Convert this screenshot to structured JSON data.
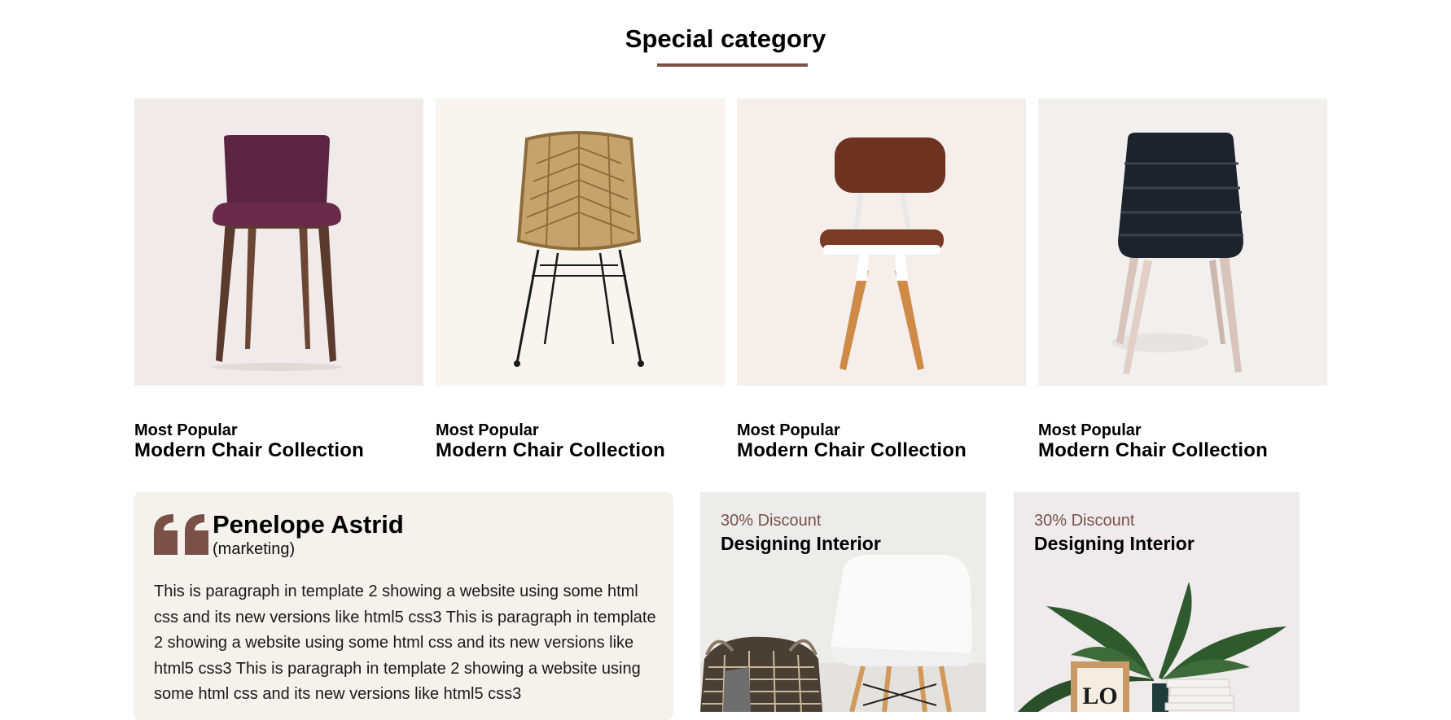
{
  "section": {
    "title": "Special category"
  },
  "cards": [
    {
      "tag": "Most Popular",
      "title": "Modern Chair Collection"
    },
    {
      "tag": "Most Popular",
      "title": "Modern Chair Collection"
    },
    {
      "tag": "Most Popular",
      "title": "Modern Chair Collection"
    },
    {
      "tag": "Most Popular",
      "title": "Modern Chair Collection"
    }
  ],
  "testimonial": {
    "name": "Penelope Astrid",
    "role": "(marketing)",
    "text": "This is paragraph in template 2 showing a website using some html css and its new versions like html5 css3 This is paragraph in template 2 showing a website using some html css and its new versions like html5 css3 This is paragraph in template 2 showing a website using some html css and its new versions like html5 css3"
  },
  "promos": [
    {
      "discount": "30% Discount",
      "title": "Designing Interior"
    },
    {
      "discount": "30% Discount",
      "title": "Designing Interior"
    }
  ],
  "colors": {
    "accent": "#7a5148",
    "card_bg_1": "#f0eaea",
    "card_bg_2": "#f8f4ef",
    "card_bg_3": "#f6eeeb",
    "card_bg_4": "#f1f0ee",
    "testimonial_bg": "#f5f1ed"
  }
}
